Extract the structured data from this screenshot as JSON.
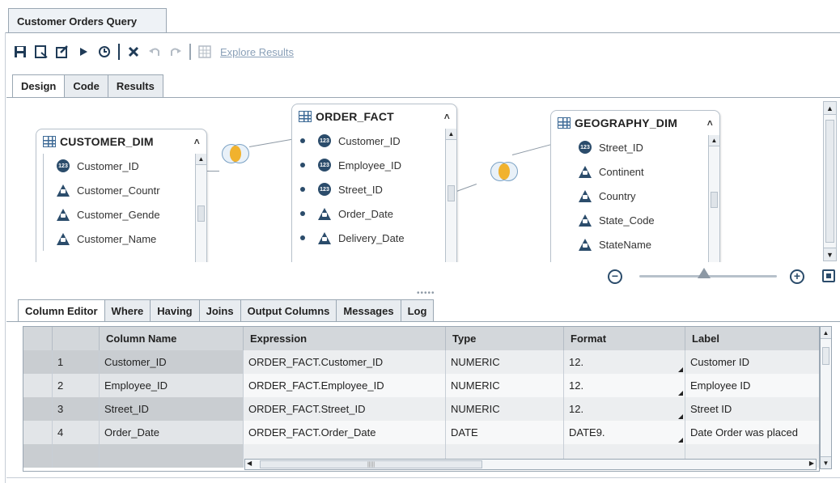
{
  "window": {
    "tab_title": "Customer Orders Query"
  },
  "toolbar": {
    "explore_label": "Explore Results",
    "icons": [
      "save-icon",
      "save-as-icon",
      "properties-icon",
      "run-icon",
      "schedule-icon",
      "delete-icon",
      "undo-icon",
      "redo-icon",
      "explore-icon"
    ]
  },
  "design_tabs": [
    {
      "label": "Design",
      "active": true
    },
    {
      "label": "Code",
      "active": false
    },
    {
      "label": "Results",
      "active": false
    }
  ],
  "tables": {
    "customer_dim": {
      "title": "CUSTOMER_DIM",
      "columns": [
        {
          "name": "Customer_ID",
          "type": "numeric"
        },
        {
          "name": "Customer_Countr",
          "type": "character"
        },
        {
          "name": "Customer_Gende",
          "type": "character"
        },
        {
          "name": "Customer_Name",
          "type": "character"
        }
      ]
    },
    "order_fact": {
      "title": "ORDER_FACT",
      "columns": [
        {
          "name": "Customer_ID",
          "type": "numeric"
        },
        {
          "name": "Employee_ID",
          "type": "numeric"
        },
        {
          "name": "Street_ID",
          "type": "numeric"
        },
        {
          "name": "Order_Date",
          "type": "character"
        },
        {
          "name": "Delivery_Date",
          "type": "character"
        }
      ]
    },
    "geography_dim": {
      "title": "GEOGRAPHY_DIM",
      "columns": [
        {
          "name": "Street_ID",
          "type": "numeric"
        },
        {
          "name": "Continent",
          "type": "character"
        },
        {
          "name": "Country",
          "type": "character"
        },
        {
          "name": "State_Code",
          "type": "character"
        },
        {
          "name": "StateName",
          "type": "character"
        }
      ]
    }
  },
  "numeric_badge": "123",
  "bottom_tabs": [
    {
      "label": "Column Editor",
      "active": true
    },
    {
      "label": "Where",
      "active": false
    },
    {
      "label": "Having",
      "active": false
    },
    {
      "label": "Joins",
      "active": false
    },
    {
      "label": "Output Columns",
      "active": false
    },
    {
      "label": "Messages",
      "active": false
    },
    {
      "label": "Log",
      "active": false
    }
  ],
  "grid": {
    "headers": [
      "",
      "",
      "Column Name",
      "Expression",
      "Type",
      "Format",
      "Label"
    ],
    "rows": [
      {
        "num": "1",
        "column_name": "Customer_ID",
        "expression": "ORDER_FACT.Customer_ID",
        "type": "NUMERIC",
        "format": "12.",
        "label": "Customer ID"
      },
      {
        "num": "2",
        "column_name": "Employee_ID",
        "expression": "ORDER_FACT.Employee_ID",
        "type": "NUMERIC",
        "format": "12.",
        "label": "Employee ID"
      },
      {
        "num": "3",
        "column_name": "Street_ID",
        "expression": "ORDER_FACT.Street_ID",
        "type": "NUMERIC",
        "format": "12.",
        "label": "Street ID"
      },
      {
        "num": "4",
        "column_name": "Order_Date",
        "expression": "ORDER_FACT.Order_Date",
        "type": "DATE",
        "format": "DATE9.",
        "label": "Date Order was placed"
      }
    ]
  },
  "colors": {
    "icon_dark": "#2b4c6b",
    "join_fill": "#f1b22e",
    "header_bg": "#d3d7db"
  }
}
